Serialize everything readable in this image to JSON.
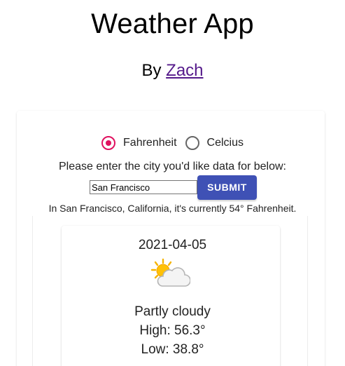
{
  "header": {
    "title": "Weather App",
    "by_prefix": "By",
    "author_link": "Zach"
  },
  "units": {
    "options": [
      {
        "label": "Fahrenheit",
        "checked": true
      },
      {
        "label": "Celcius",
        "checked": false
      }
    ]
  },
  "form": {
    "prompt": "Please enter the city you'd like data for below:",
    "city_value": "San Francisco",
    "submit_label": "SUBMIT"
  },
  "result": {
    "text": "In San Francisco, California, it's currently 54° Fahrenheit."
  },
  "forecast": {
    "date": "2021-04-05",
    "icon": "partly-cloudy-icon",
    "condition": "Partly cloudy",
    "high": "High: 56.3°",
    "low": "Low: 38.8°"
  },
  "colors": {
    "radio_accent": "#e0115f",
    "button": "#3f51b5",
    "link": "#551a8b"
  }
}
